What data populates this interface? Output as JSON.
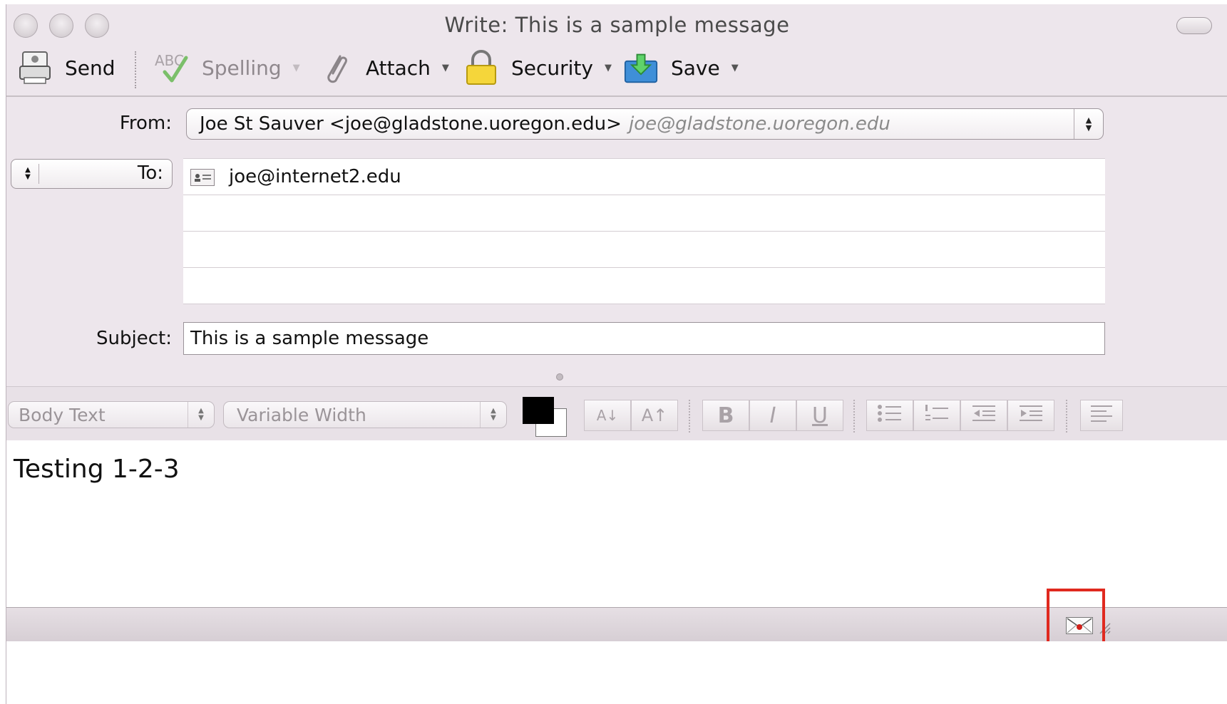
{
  "window": {
    "title": "Write: This is a sample message"
  },
  "toolbar": {
    "send_label": "Send",
    "spelling_label": "Spelling",
    "attach_label": "Attach",
    "security_label": "Security",
    "save_label": "Save",
    "spelling_icon_text": "ABC"
  },
  "header": {
    "from_label": "From:",
    "from_value": "Joe St Sauver <joe@gladstone.uoregon.edu>",
    "from_account": "joe@gladstone.uoregon.edu",
    "to_label": "To:",
    "recipients": [
      "joe@internet2.edu",
      "",
      "",
      ""
    ],
    "subject_label": "Subject:",
    "subject_value": "This is a sample message"
  },
  "format_bar": {
    "paragraph_style": "Body Text",
    "font": "Variable Width",
    "text_color": "#000000",
    "background_color": "#ffffff",
    "smaller_label": "A",
    "larger_label": "A",
    "bold_label": "B",
    "italic_label": "I",
    "underline_label": "U"
  },
  "message": {
    "body": "Testing 1-2-3"
  },
  "status": {
    "highlight_color": "#e0291f"
  }
}
